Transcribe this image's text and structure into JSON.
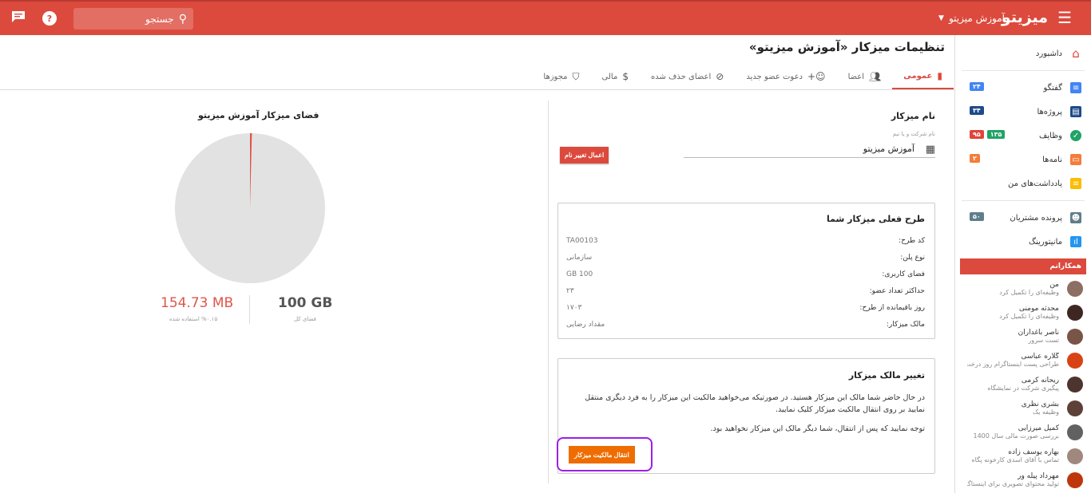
{
  "topbar": {
    "brand": "میزیتو",
    "workspace_select": "آموزش میزیتو",
    "search_placeholder": "جستجو"
  },
  "sidebar": {
    "items": [
      {
        "label": "داشبورد",
        "icon": "home-icon",
        "color": "#e0443a"
      },
      {
        "label": "گفتگو",
        "icon": "chat-icon",
        "color": "#4285f4",
        "badges": [
          {
            "text": "۲۴",
            "color": "#4285f4"
          }
        ]
      },
      {
        "label": "پروژه‌ها",
        "icon": "projects-icon",
        "color": "#1e4a8a",
        "badges": [
          {
            "text": "۳۴",
            "color": "#1e4a8a"
          }
        ]
      },
      {
        "label": "وظایف",
        "icon": "check-icon",
        "color": "#21a366",
        "badges": [
          {
            "text": "۱۳۵",
            "color": "#21a366"
          },
          {
            "text": "۹۵",
            "color": "#e0443a"
          }
        ]
      },
      {
        "label": "نامه‌ها",
        "icon": "letter-icon",
        "color": "#f57c3b",
        "badges": [
          {
            "text": "۲",
            "color": "#f57c3b"
          }
        ]
      },
      {
        "label": "یادداشت‌های من",
        "icon": "note-icon",
        "color": "#fbbc04"
      },
      {
        "label": "پرونده مشتریان",
        "icon": "customer-icon",
        "color": "#607d8b",
        "badges": [
          {
            "text": "۵۰",
            "color": "#607d8b"
          }
        ]
      },
      {
        "label": "مانیتورینگ",
        "icon": "chart-icon",
        "color": "#2196f3"
      }
    ],
    "colleagues_title": "همکارانم",
    "colleagues": [
      {
        "name": "من",
        "status": "وظیفه‌ای را تکمیل کرد",
        "color": "#8d6e63"
      },
      {
        "name": "محدثه مومنی",
        "status": "وظیفه‌ای را تکمیل کرد",
        "color": "#3e2723"
      },
      {
        "name": "ناصر باغداران",
        "status": "تست سرور",
        "color": "#795548"
      },
      {
        "name": "گلاره عباسی",
        "status": "طراحی پست اینستاگرام روز درخت ...",
        "color": "#d84315"
      },
      {
        "name": "ریحانه کرمی",
        "status": "پیگیری شرکت در نمایشگاه",
        "color": "#4e342e"
      },
      {
        "name": "بشری نظری",
        "status": "وظیفه یک",
        "color": "#5d4037"
      },
      {
        "name": "کمیل میرزایی",
        "status": "بررسی صورت مالی سال 1400",
        "color": "#616161"
      },
      {
        "name": "بهاره یوسف زاده",
        "status": "تماس با آقای اسدی کارخونه پگاه",
        "color": "#a1887f"
      },
      {
        "name": "مهرداد پیله ور",
        "status": "تولید محتوای تصویری برای اینستاگرام",
        "color": "#bf360c"
      }
    ]
  },
  "header": {
    "title": "تنظیمات میزکار «آموزش میزیتو»",
    "tabs": [
      {
        "label": "عمومی",
        "icon": "book-icon"
      },
      {
        "label": "اعضا",
        "icon": "group-icon"
      },
      {
        "label": "دعوت عضو جدید",
        "icon": "person-add-icon"
      },
      {
        "label": "اعضای حذف شده",
        "icon": "block-icon"
      },
      {
        "label": "مالی",
        "icon": "dollar-icon"
      },
      {
        "label": "مجوزها",
        "icon": "shield-icon"
      }
    ]
  },
  "workspace_name": {
    "title": "نام میزکار",
    "field_label": "نام شرکت و یا تیم",
    "value": "آموزش میزیتو",
    "apply_button": "اعمال تغییر نام"
  },
  "plan": {
    "title": "طرح فعلی میزکار شما",
    "rows": [
      {
        "key": "کد طرح:",
        "value": "TA00103"
      },
      {
        "key": "نوع پلن:",
        "value": "سازمانی"
      },
      {
        "key": "فضای کاربری:",
        "value": "100 GB"
      },
      {
        "key": "حداکثر تعداد عضو:",
        "value": "۲۳"
      },
      {
        "key": "روز باقیمانده از طرح:",
        "value": "۱۷۰۳"
      },
      {
        "key": "مالک میزکار:",
        "value": "مقداد رضایی"
      }
    ]
  },
  "owner_change": {
    "title": "تغییر مالک میزکار",
    "text": "در حال حاضر شما مالک این میزکار هستید. در صورتیکه می‌خواهید مالکیت این میزکار را به فرد دیگری منتقل نمایید بر روی انتقال مالکیت میزکار کلیک نمایید.",
    "note": "توجه نمایید که پس از انتقال، شما دیگر مالک این میزکار نخواهید بود.",
    "button": "انتقال مالکیت میزکار"
  },
  "storage": {
    "title": "فضای میزکار آموزش میزیتو",
    "used": "154.73 MB",
    "used_label": "%۰.۱۵ استفاده شده",
    "used_fraction": 0.0015,
    "total": "100 GB",
    "total_label": "فضای کل",
    "used_color": "#e0544a",
    "free_color": "#e2e2e2"
  }
}
